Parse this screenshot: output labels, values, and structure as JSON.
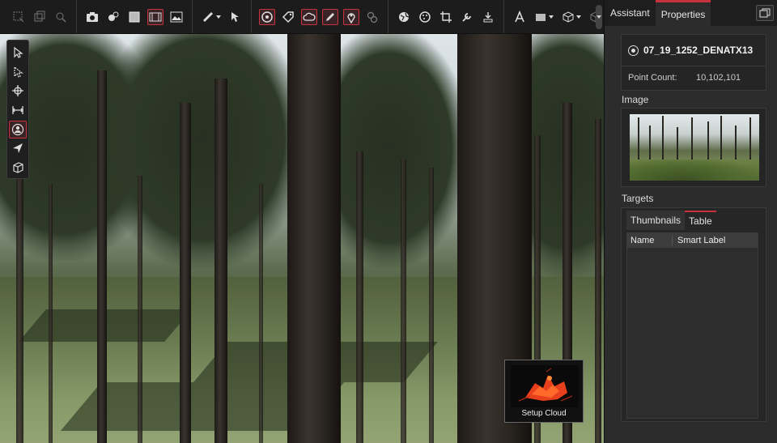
{
  "panel": {
    "tabs": [
      {
        "label": "Assistant"
      },
      {
        "label": "Properties"
      }
    ],
    "scan_title": "07_19_1252_DENATX13",
    "point_count_label": "Point Count:",
    "point_count_value": "10,102,101",
    "image_label": "Image",
    "targets_label": "Targets",
    "target_tabs": [
      {
        "label": "Thumbnails"
      },
      {
        "label": "Table"
      }
    ],
    "table_columns": [
      "Name",
      "Smart Label"
    ]
  },
  "viewport": {
    "setup_cloud_label": "Setup Cloud"
  },
  "toolbar": {
    "groups": [
      [
        "box-select-icon",
        "copy-icon",
        "zoom-icon"
      ],
      [
        "camera-icon",
        "share-icon",
        "square-icon",
        "panorama-icon",
        "image-icon"
      ],
      [
        "ruler-icon",
        "cursor-icon"
      ],
      [
        "target-icon",
        "tag-icon",
        "cloud-icon",
        "pencil-icon",
        "pin-icon",
        "link-icon"
      ],
      [
        "globe-icon",
        "palette-icon",
        "crop-icon",
        "wrench-icon",
        "download-icon"
      ],
      [
        "font-icon",
        "rect-dropdown-icon",
        "cube-dropdown-icon",
        "cube-icon"
      ]
    ]
  },
  "colors": {
    "accent": "#c8323c",
    "panel_bg": "#2c2c2c",
    "toolbar_bg": "#1c1c1c"
  }
}
